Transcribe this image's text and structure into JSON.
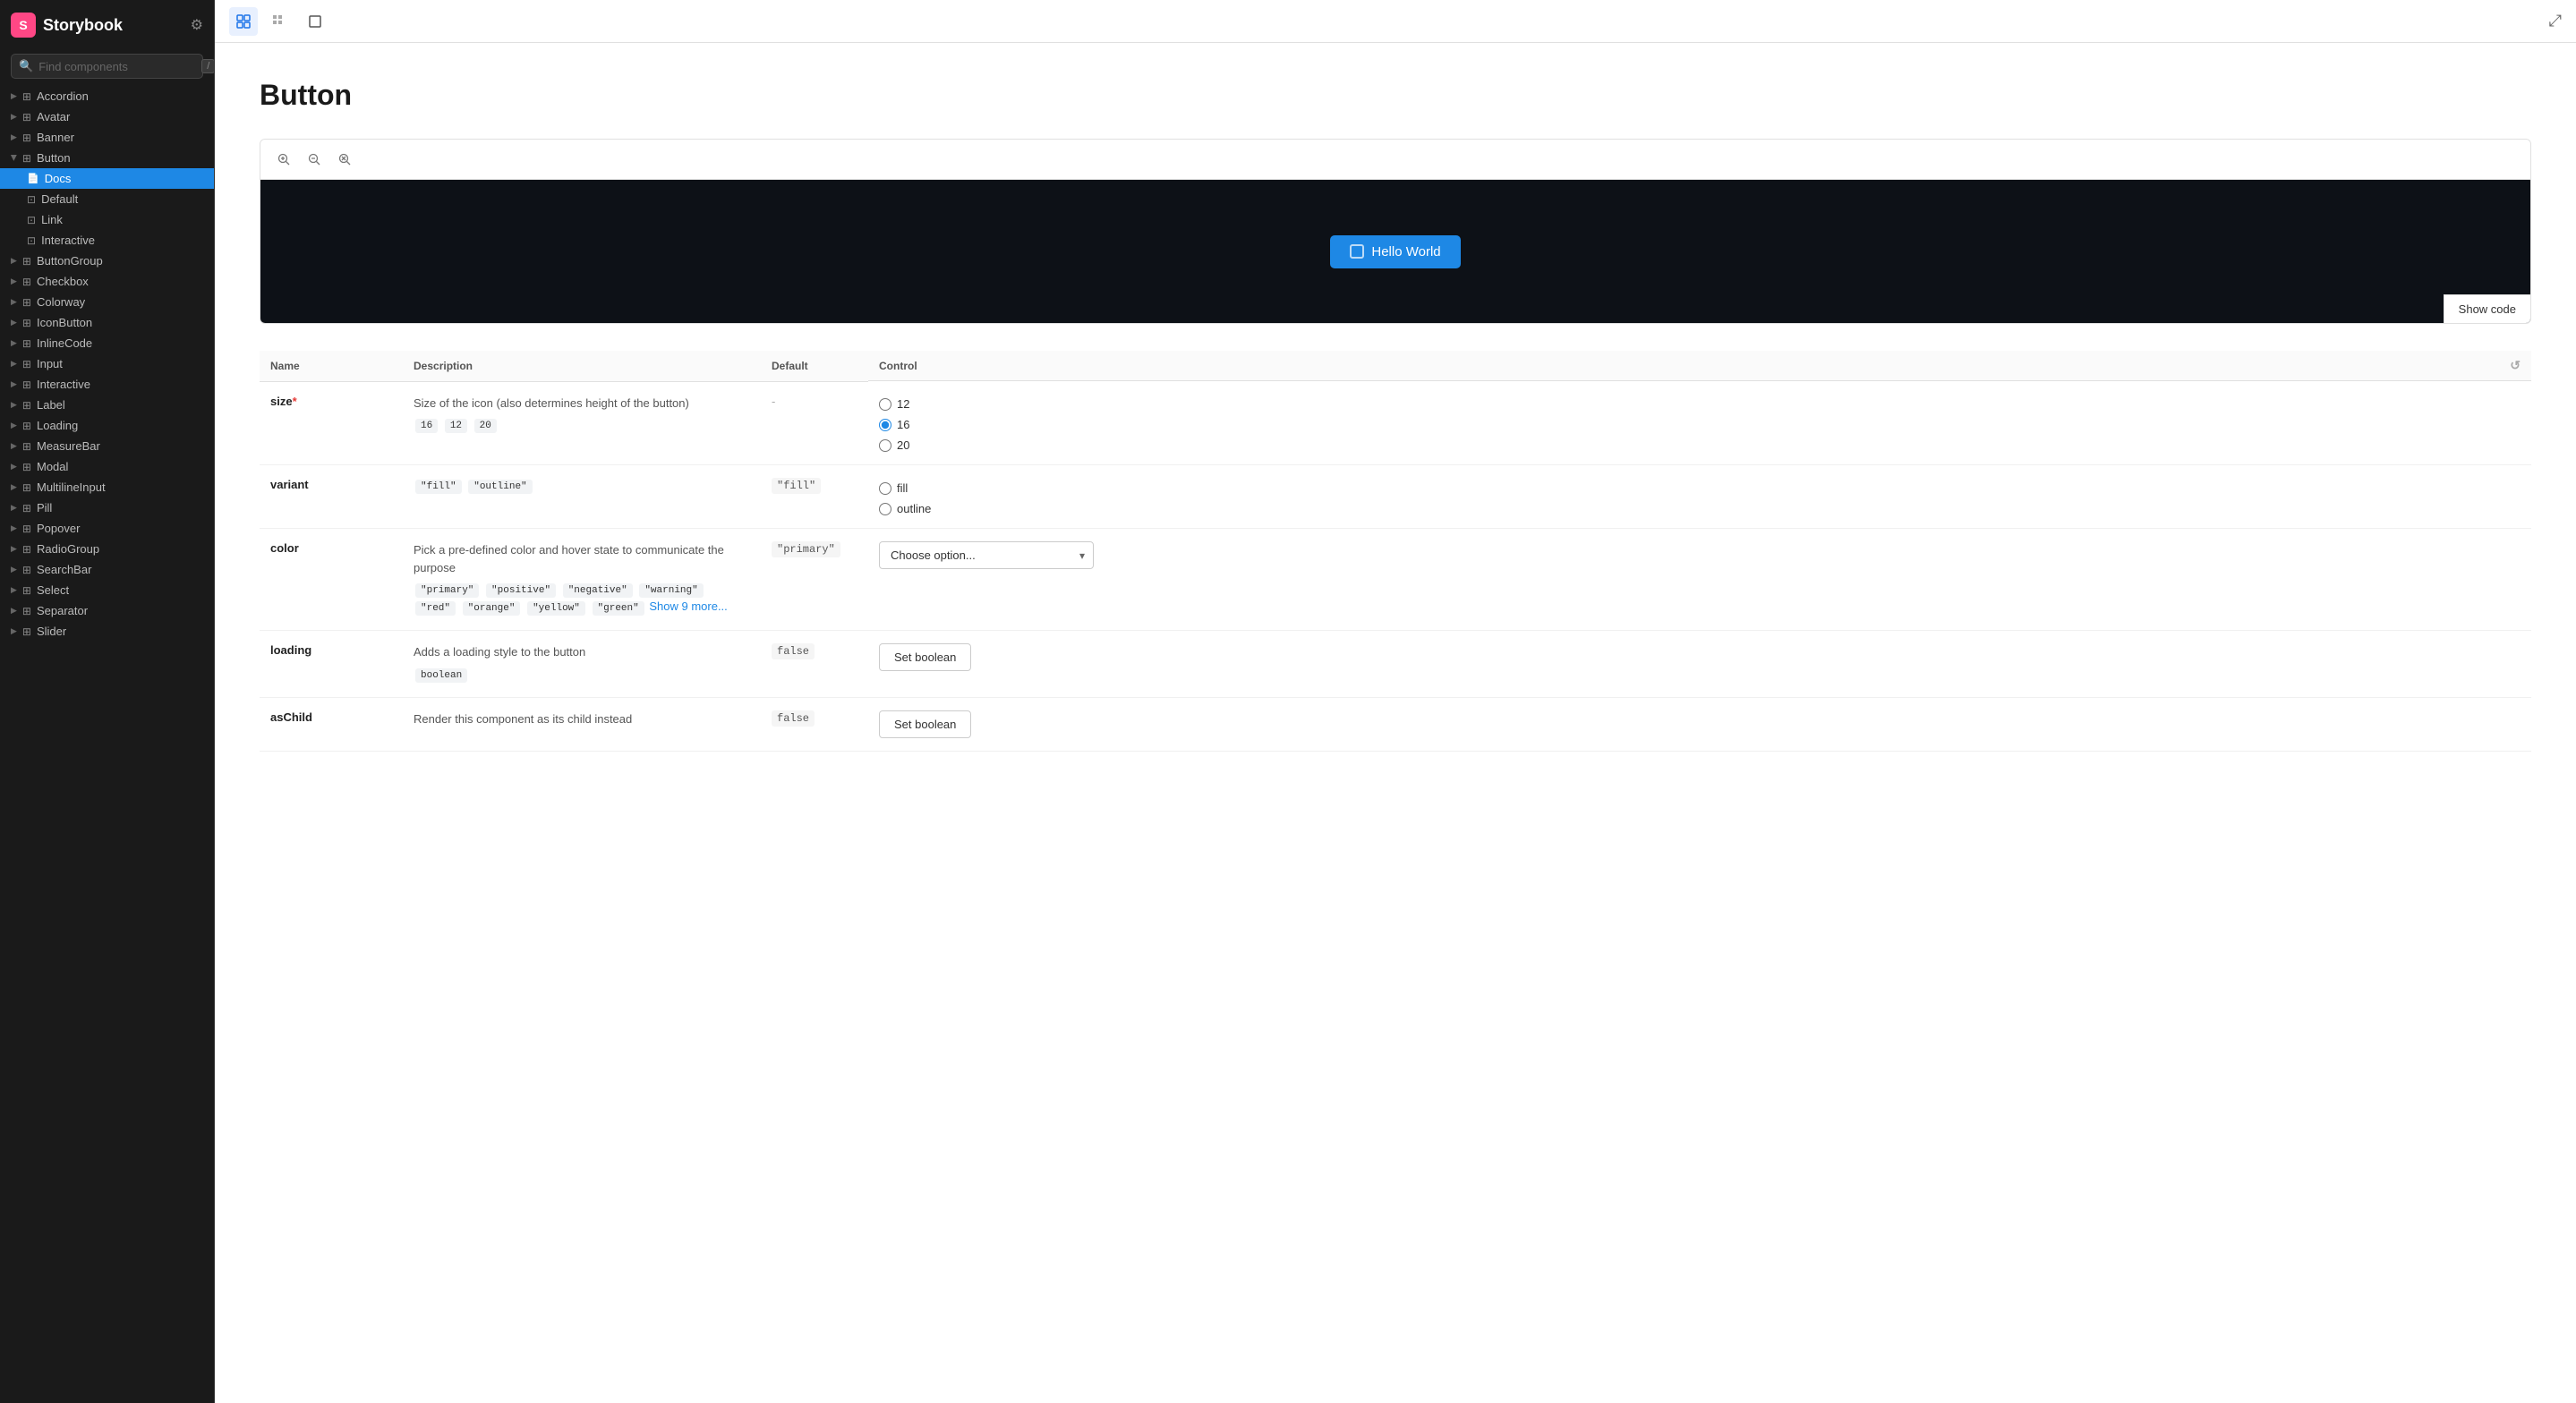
{
  "sidebar": {
    "brand": {
      "logo": "S",
      "title": "Storybook"
    },
    "search": {
      "placeholder": "Find components",
      "shortcut": "/"
    },
    "nav": [
      {
        "id": "accordion",
        "label": "Accordion",
        "level": 0,
        "expanded": false
      },
      {
        "id": "avatar",
        "label": "Avatar",
        "level": 0,
        "expanded": false
      },
      {
        "id": "banner",
        "label": "Banner",
        "level": 0,
        "expanded": false
      },
      {
        "id": "button",
        "label": "Button",
        "level": 0,
        "expanded": true
      },
      {
        "id": "button-docs",
        "label": "Docs",
        "level": 1,
        "active": true,
        "type": "doc"
      },
      {
        "id": "button-default",
        "label": "Default",
        "level": 1,
        "type": "story"
      },
      {
        "id": "button-link",
        "label": "Link",
        "level": 1,
        "type": "story"
      },
      {
        "id": "button-interactive",
        "label": "Interactive",
        "level": 1,
        "type": "story"
      },
      {
        "id": "buttongroup",
        "label": "ButtonGroup",
        "level": 0,
        "expanded": false
      },
      {
        "id": "checkbox",
        "label": "Checkbox",
        "level": 0
      },
      {
        "id": "colorway",
        "label": "Colorway",
        "level": 0
      },
      {
        "id": "iconbutton",
        "label": "IconButton",
        "level": 0
      },
      {
        "id": "inlinecode",
        "label": "InlineCode",
        "level": 0
      },
      {
        "id": "input",
        "label": "Input",
        "level": 0
      },
      {
        "id": "interactive",
        "label": "Interactive",
        "level": 0
      },
      {
        "id": "label",
        "label": "Label",
        "level": 0
      },
      {
        "id": "loading",
        "label": "Loading",
        "level": 0
      },
      {
        "id": "measurebar",
        "label": "MeasureBar",
        "level": 0
      },
      {
        "id": "modal",
        "label": "Modal",
        "level": 0
      },
      {
        "id": "multilineinput",
        "label": "MultilineInput",
        "level": 0
      },
      {
        "id": "pill",
        "label": "Pill",
        "level": 0
      },
      {
        "id": "popover",
        "label": "Popover",
        "level": 0
      },
      {
        "id": "radiogroup",
        "label": "RadioGroup",
        "level": 0
      },
      {
        "id": "searchbar",
        "label": "SearchBar",
        "level": 0
      },
      {
        "id": "select",
        "label": "Select",
        "level": 0
      },
      {
        "id": "separator",
        "label": "Separator",
        "level": 0
      },
      {
        "id": "slider",
        "label": "Slider",
        "level": 0
      }
    ]
  },
  "toolbar": {
    "buttons": [
      {
        "id": "canvas",
        "icon": "⊞",
        "active": true
      },
      {
        "id": "grid",
        "icon": "⊟",
        "active": false
      },
      {
        "id": "border",
        "icon": "◻",
        "active": false
      }
    ],
    "expand_icon": "⤢"
  },
  "page": {
    "title": "Button",
    "preview": {
      "button_label": "Hello World",
      "show_code_label": "Show code"
    },
    "controls_table": {
      "headers": [
        "Name",
        "Description",
        "Default",
        "Control"
      ],
      "rows": [
        {
          "name": "size",
          "required": true,
          "description": "Size of the icon (also determines height of the button)",
          "tags": [
            "16",
            "12",
            "20"
          ],
          "default": "-",
          "control_type": "radio",
          "options": [
            "12",
            "16",
            "20"
          ],
          "selected": "16"
        },
        {
          "name": "variant",
          "required": false,
          "description": "",
          "tags": [
            "\"fill\"",
            "\"outline\""
          ],
          "default": "\"fill\"",
          "control_type": "radio",
          "options": [
            "fill",
            "outline"
          ],
          "selected": null
        },
        {
          "name": "color",
          "required": false,
          "description": "Pick a pre-defined color and hover state to communicate the purpose",
          "tags": [
            "\"primary\"",
            "\"positive\"",
            "\"negative\"",
            "\"warning\"",
            "\"red\"",
            "\"orange\"",
            "\"yellow\"",
            "\"green\""
          ],
          "show_more": "Show 9 more...",
          "default": "\"primary\"",
          "control_type": "select",
          "placeholder": "Choose option...",
          "options": [
            "primary",
            "positive",
            "negative",
            "warning",
            "red",
            "orange",
            "yellow",
            "green"
          ]
        },
        {
          "name": "loading",
          "required": false,
          "description": "Adds a loading style to the button",
          "tags": [
            "boolean"
          ],
          "default": "false",
          "control_type": "boolean",
          "button_label": "Set boolean"
        },
        {
          "name": "asChild",
          "required": false,
          "description": "Render this component as its child instead",
          "tags": [],
          "default": "false",
          "control_type": "boolean",
          "button_label": "Set boolean"
        }
      ]
    }
  }
}
